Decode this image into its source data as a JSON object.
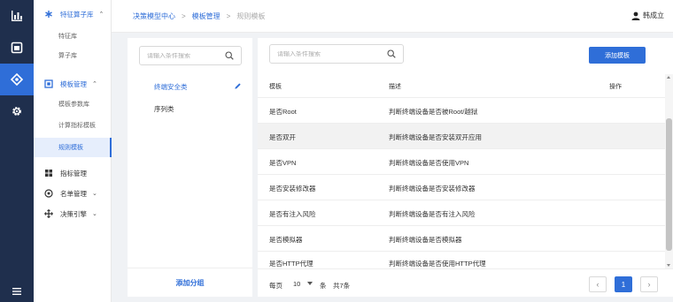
{
  "breadcrumb": {
    "items": [
      "决策模型中心",
      "模板管理",
      "规则模板"
    ],
    "separator": ">"
  },
  "user": {
    "name": "韩成立",
    "icon": "user-icon"
  },
  "rail": {
    "items": [
      "chart-icon",
      "window-icon",
      "diamond-icon",
      "gear-icon"
    ],
    "bottom": "hamburger-icon"
  },
  "menu": {
    "feature_group": {
      "label": "特征算子库"
    },
    "feature_items": [
      "特征库",
      "算子库"
    ],
    "template_group": {
      "label": "模板管理"
    },
    "template_items": [
      "模板参数库",
      "计算指标模板",
      "规则模板"
    ],
    "other_groups": [
      {
        "label": "指标管理"
      },
      {
        "label": "名单管理"
      },
      {
        "label": "决策引擎"
      }
    ]
  },
  "categories": {
    "search_placeholder": "请输入条件搜索",
    "items": [
      "终端安全类",
      "序列类"
    ],
    "add_label": "添加分组"
  },
  "templates": {
    "search_placeholder": "请输入条件搜索",
    "add_label": "添加模板",
    "columns": [
      "模板",
      "描述",
      "操作"
    ],
    "rows": [
      {
        "name": "是否Root",
        "desc": "判断终端设备是否被Root/越狱"
      },
      {
        "name": "是否双开",
        "desc": "判断终端设备是否安装双开应用"
      },
      {
        "name": "是否VPN",
        "desc": "判断终端设备是否使用VPN"
      },
      {
        "name": "是否安装修改器",
        "desc": "判断终端设备是否安装修改器"
      },
      {
        "name": "是否有注入风险",
        "desc": "判断终端设备是否有注入风险"
      },
      {
        "name": "是否模拟器",
        "desc": "判断终端设备是否模拟器"
      },
      {
        "name": "是否HTTP代理",
        "desc": "判断终端设备是否使用HTTP代理"
      }
    ]
  },
  "pagination": {
    "per_page_label": "每页",
    "page_size": "10",
    "unit": "条",
    "total": "共7条",
    "current": "1"
  },
  "colors": {
    "accent": "#2f6ed8",
    "rail": "#1f2f4d"
  }
}
